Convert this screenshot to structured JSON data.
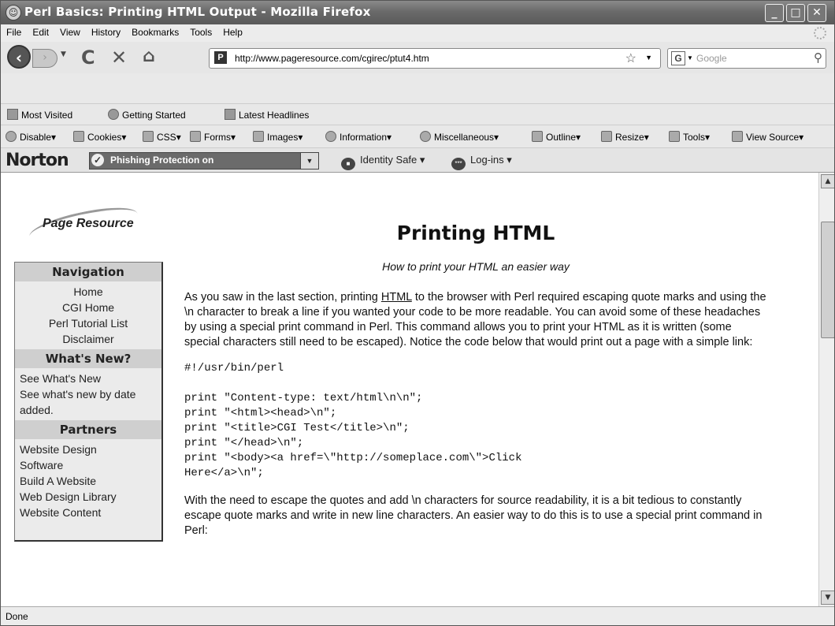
{
  "window": {
    "title": "Perl Basics: Printing HTML Output - Mozilla Firefox"
  },
  "menu": [
    "File",
    "Edit",
    "View",
    "History",
    "Bookmarks",
    "Tools",
    "Help"
  ],
  "toolbar": {
    "url": "http://www.pageresource.com/cgirec/ptut4.htm",
    "search_placeholder": "Google"
  },
  "bookmarks": [
    "Most Visited",
    "Getting Started",
    "Latest Headlines"
  ],
  "devbar": [
    "Disable",
    "Cookies",
    "CSS",
    "Forms",
    "Images",
    "Information",
    "Miscellaneous",
    "Outline",
    "Resize",
    "Tools",
    "View Source"
  ],
  "norton": {
    "logo": "Norton",
    "phishing": "Phishing Protection on",
    "identity": "Identity Safe",
    "logins": "Log-ins"
  },
  "page": {
    "logo_text": "Page Resource",
    "title": "Printing HTML",
    "subtitle": "How to print your HTML an easier way",
    "para1_a": "As you saw in the last section, printing ",
    "para1_link": "HTML",
    "para1_b": " to the browser with Perl required escaping quote marks and using the \\n character to break a line if you wanted your code to be more readable. You can avoid some of these headaches by using a special print command in Perl. This command allows you to print your HTML as it is written (some special characters still need to be escaped). Notice the code below that would print out a page with a simple link:",
    "code1": "#!/usr/bin/perl",
    "code2": "print \"Content-type: text/html\\n\\n\";\nprint \"<html><head>\\n\";\nprint \"<title>CGI Test</title>\\n\";\nprint \"</head>\\n\";\nprint \"<body><a href=\\\"http://someplace.com\\\">Click\nHere</a>\\n\";",
    "para2": "With the need to escape the quotes and add \\n characters for source readability, it is a bit tedious to constantly escape quote marks and write in new line characters. An easier way to do this is to use a special print command in Perl:"
  },
  "sidebar": {
    "nav_heading": "Navigation",
    "nav_links": [
      "Home",
      "CGI Home",
      "Perl Tutorial List",
      "Disclaimer"
    ],
    "whats_new_heading": "What's New?",
    "whats_new_links": [
      "See What's New",
      "See what's new by date added."
    ],
    "partners_heading": "Partners",
    "partners_links": [
      "Website Design",
      "Software",
      "Build A Website",
      "Web Design Library",
      "Website Content"
    ]
  },
  "status": "Done"
}
